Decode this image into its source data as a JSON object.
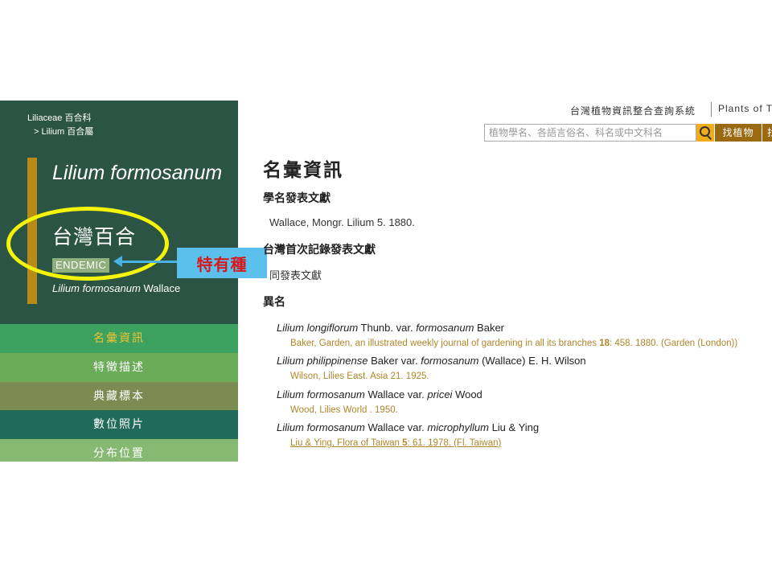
{
  "breadcrumb": {
    "family": "Liliaceae 百合科",
    "genus": "> Lilium 百合屬"
  },
  "species": {
    "scientific_name": "Lilium formosanum",
    "chinese_name": "台灣百合",
    "status_badge": "ENDEMIC",
    "authority_italic": "Lilium formosanum",
    "authority_author": " Wallace"
  },
  "annotation": {
    "label": "特有種"
  },
  "nav": [
    {
      "label": "名彙資訊"
    },
    {
      "label": "特徵描述"
    },
    {
      "label": "典藏標本"
    },
    {
      "label": "數位照片"
    },
    {
      "label": "分布位置"
    }
  ],
  "header": {
    "system_title": "台灣植物資訊整合查詢系統",
    "system_title_en": "Plants of Ta",
    "search_placeholder": "植物學名、各語言俗名、科名或中文科名",
    "find_button": "找植物",
    "next_button": "找"
  },
  "main": {
    "title": "名彙資訊",
    "publication_heading": "學名發表文獻",
    "publication_text": "Wallace, Mongr. Lilium 5. 1880.",
    "first_record_heading": "台灣首次記錄發表文獻",
    "first_record_text": "同發表文獻",
    "synonyms_heading": "異名",
    "synonyms": [
      {
        "genus_species": "Lilium longiflorum",
        "author1": " Thunb. var. ",
        "variety": "formosanum",
        "author2": " Baker",
        "ref_pre": "Baker, Garden, an illustrated weekly journal of gardening in all its branches ",
        "ref_vol": "18",
        "ref_post": ": 458. 1880.  (Garden (London))"
      },
      {
        "genus_species": "Lilium philippinense",
        "author1": " Baker var. ",
        "variety": "formosanum",
        "author2": " (Wallace) E. H. Wilson",
        "ref_pre": "Wilson, Lilies East. Asia 21. 1925.",
        "ref_vol": "",
        "ref_post": ""
      },
      {
        "genus_species": "Lilium formosanum",
        "author1": " Wallace var. ",
        "variety": "pricei",
        "author2": " Wood",
        "ref_pre": "Wood, Lilies World . 1950.",
        "ref_vol": "",
        "ref_post": ""
      },
      {
        "genus_species": "Lilium formosanum",
        "author1": " Wallace var. ",
        "variety": "microphyllum",
        "author2": " Liu & Ying",
        "ref_pre": "Liu & Ying, Flora of Taiwan ",
        "ref_vol": "5",
        "ref_post": ": 61. 1978.  (Fl. Taiwan)"
      }
    ]
  },
  "colors": {
    "panel_bg": "#2c5444",
    "accent": "#b88a17",
    "reference_text": "#b0862a",
    "annotation_circle": "#f4f40a",
    "annotation_box": "#5bc0eb",
    "annotation_text": "#d9181d"
  },
  "icons": {
    "search": "search-icon"
  }
}
